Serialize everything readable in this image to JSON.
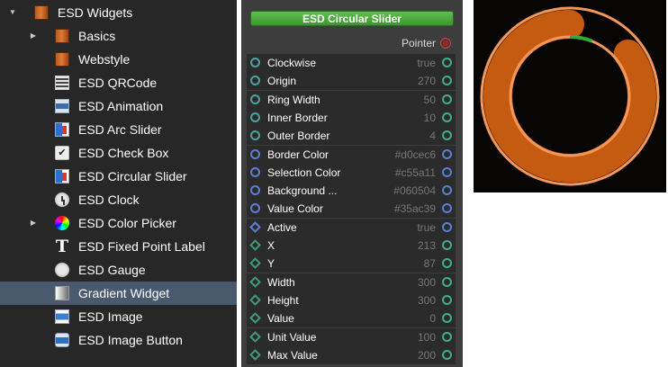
{
  "tree": {
    "items": [
      {
        "label": "ESD Widgets",
        "icon": "folder-icon",
        "expander": "expanded"
      },
      {
        "label": "Basics",
        "icon": "folder-icon",
        "expander": "collapsed"
      },
      {
        "label": "Webstyle",
        "icon": "folder-icon",
        "expander": ""
      },
      {
        "label": "ESD QRCode",
        "icon": "qrcode-icon",
        "expander": ""
      },
      {
        "label": "ESD Animation",
        "icon": "animation-icon",
        "expander": ""
      },
      {
        "label": "ESD Arc Slider",
        "icon": "arc-slider-icon",
        "expander": ""
      },
      {
        "label": "ESD Check Box",
        "icon": "checkbox-icon",
        "expander": ""
      },
      {
        "label": "ESD Circular Slider",
        "icon": "circular-slider-icon",
        "expander": ""
      },
      {
        "label": "ESD Clock",
        "icon": "clock-icon",
        "expander": ""
      },
      {
        "label": "ESD Color Picker",
        "icon": "color-picker-icon",
        "expander": "collapsed"
      },
      {
        "label": "ESD Fixed Point Label",
        "icon": "text-icon",
        "expander": ""
      },
      {
        "label": "ESD Gauge",
        "icon": "gauge-icon",
        "expander": ""
      },
      {
        "label": "Gradient Widget",
        "icon": "gradient-icon",
        "expander": "",
        "selected": true
      },
      {
        "label": "ESD Image",
        "icon": "image-icon",
        "expander": ""
      },
      {
        "label": "ESD Image Button",
        "icon": "image-button-icon",
        "expander": ""
      }
    ]
  },
  "node": {
    "title": "ESD Circular Slider",
    "pointer_label": "Pointer",
    "properties": [
      {
        "name": "Clockwise",
        "value": "true",
        "port": "circle"
      },
      {
        "name": "Origin",
        "value": "270",
        "port": "circle"
      },
      {
        "name": "Ring Width",
        "value": "50",
        "port": "circle"
      },
      {
        "name": "Inner Border",
        "value": "10",
        "port": "circle"
      },
      {
        "name": "Outer Border",
        "value": "4",
        "port": "circle"
      },
      {
        "name": "Border Color",
        "value": "#d0cec6",
        "port": "circle-blue"
      },
      {
        "name": "Selection Color",
        "value": "#c55a11",
        "port": "circle-blue"
      },
      {
        "name": "Background ...",
        "value": "#060504",
        "port": "circle-blue"
      },
      {
        "name": "Value Color",
        "value": "#35ac39",
        "port": "circle-blue"
      },
      {
        "name": "Active",
        "value": "true",
        "port": "diamond-blue"
      },
      {
        "name": "X",
        "value": "213",
        "port": "diamond"
      },
      {
        "name": "Y",
        "value": "87",
        "port": "diamond"
      },
      {
        "name": "Width",
        "value": "300",
        "port": "diamond"
      },
      {
        "name": "Height",
        "value": "300",
        "port": "diamond"
      },
      {
        "name": "Value",
        "value": "0",
        "port": "diamond"
      },
      {
        "name": "Unit Value",
        "value": "100",
        "port": "diamond"
      },
      {
        "name": "Max Value",
        "value": "200",
        "port": "diamond"
      }
    ]
  },
  "preview": {
    "background": "#060504",
    "ring_color": "#c55a11",
    "border_color": "#f4975a",
    "value_color": "#35ac39",
    "value_fraction": 0.06,
    "selection_fraction": 0.85
  }
}
